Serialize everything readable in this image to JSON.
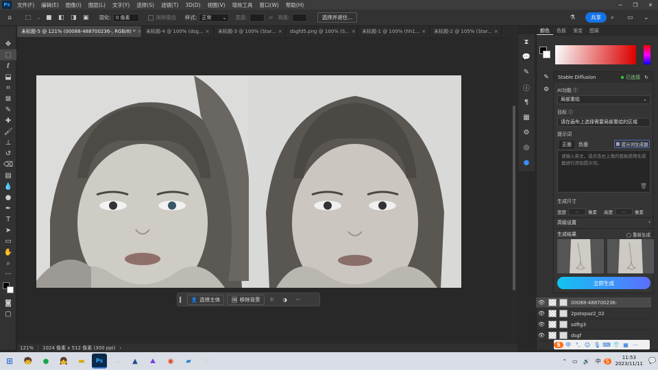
{
  "menu": {
    "logo": "Ps",
    "items": [
      "文件(F)",
      "编辑(E)",
      "图像(I)",
      "图层(L)",
      "文字(Y)",
      "选择(S)",
      "滤镜(T)",
      "3D(D)",
      "视图(V)",
      "增效工具",
      "窗口(W)",
      "帮助(H)"
    ]
  },
  "options": {
    "feather_label": "羽化:",
    "feather_value": "0 像素",
    "antialias_label": "消除锯齿",
    "style_label": "样式:",
    "style_value": "正常",
    "width_label": "宽度:",
    "height_label": "高度:",
    "select_mask_label": "选择并遮住...",
    "share_label": "共享"
  },
  "tabs": [
    {
      "label": "未标题-5 @ 121% (00088-488700236-, RGB/8) *",
      "active": true
    },
    {
      "label": "未标题-4 @ 100% (dsg...",
      "active": false
    },
    {
      "label": "未标题-3 @ 100% (Star...",
      "active": false
    },
    {
      "label": "dsgfd5.png @ 100% (S...",
      "active": false
    },
    {
      "label": "未标题-1 @ 100% (hh1...",
      "active": false
    },
    {
      "label": "未标题-2 @ 105% (Star...",
      "active": false
    }
  ],
  "context_bar": {
    "select_subject": "选择主体",
    "remove_bg": "移除背景"
  },
  "status": {
    "zoom": "121%",
    "doc_size": "1024 像素 x 512 像素 (300 ppi)"
  },
  "color_panel": {
    "tabs": [
      "颜色",
      "色板",
      "渐变",
      "图案"
    ],
    "accent": "#e00000"
  },
  "sd": {
    "title": "Stable Diffusion",
    "connected": "已连接",
    "ai_func_label": "AI功能",
    "ai_func_value": "局部重绘",
    "target_label": "目标",
    "target_value": "请在画布上选择需要局部重绘的区域",
    "prompt_label": "提示词",
    "positive_tab": "正面",
    "negative_tab": "负面",
    "suggest_btn": "提示词生成器",
    "prompt_placeholder": "请输入英文，或点击右上角的面板使用生成器进行添加提示词。",
    "size_label": "生成尺寸",
    "width_label": "宽度",
    "width_unit": "像素",
    "height_label": "高度",
    "height_unit": "像素",
    "width_value": "--",
    "height_value": "--",
    "advanced_label": "高级设置",
    "result_label": "生成结果",
    "regenerate_label": "重新生成",
    "generate_btn": "立即生成"
  },
  "layers": [
    {
      "name": "00088-488700236-",
      "active": true
    },
    {
      "name": "2pstopaz2_02",
      "active": false
    },
    {
      "name": "sdftg3",
      "active": false
    },
    {
      "name": "dsgf",
      "active": false
    }
  ],
  "taskbar": {
    "time": "11:53",
    "date": "2023/11/11",
    "ime_lang": "中",
    "ime_mode": "中"
  }
}
